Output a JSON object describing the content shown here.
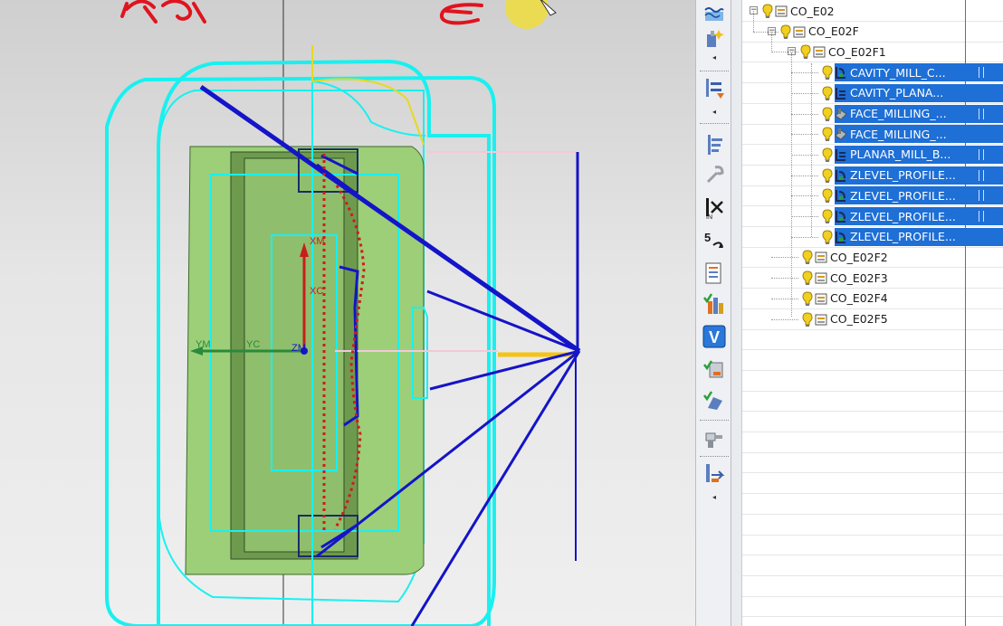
{
  "navigator": {
    "nodes": [
      {
        "label": "CO_E02",
        "level": 0,
        "type": "program",
        "expander": "−",
        "selected": false
      },
      {
        "label": "CO_E02F",
        "level": 1,
        "type": "program",
        "expander": "−",
        "selected": false
      },
      {
        "label": "CO_E02F1",
        "level": 2,
        "type": "program",
        "expander": "−",
        "selected": false
      },
      {
        "label": "CAVITY_MILL_C...",
        "level": 3,
        "type": "cavity-mill",
        "selected": true,
        "flag": true
      },
      {
        "label": "CAVITY_PLANA...",
        "level": 3,
        "type": "planar-mill",
        "selected": true,
        "flag": false
      },
      {
        "label": "FACE_MILLING_...",
        "level": 3,
        "type": "face-mill",
        "selected": true,
        "flag": true
      },
      {
        "label": "FACE_MILLING_...",
        "level": 3,
        "type": "face-mill",
        "selected": true,
        "flag": false
      },
      {
        "label": "PLANAR_MILL_B...",
        "level": 3,
        "type": "planar-mill",
        "selected": true,
        "flag": true
      },
      {
        "label": "ZLEVEL_PROFILE...",
        "level": 3,
        "type": "zlevel",
        "selected": true,
        "flag": true
      },
      {
        "label": "ZLEVEL_PROFILE...",
        "level": 3,
        "type": "zlevel",
        "selected": true,
        "flag": true
      },
      {
        "label": "ZLEVEL_PROFILE...",
        "level": 3,
        "type": "zlevel",
        "selected": true,
        "flag": true
      },
      {
        "label": "ZLEVEL_PROFILE...",
        "level": 3,
        "type": "zlevel",
        "selected": true,
        "flag": false
      },
      {
        "label": "CO_E02F2",
        "level": 2,
        "type": "program",
        "selected": false
      },
      {
        "label": "CO_E02F3",
        "level": 2,
        "type": "program",
        "selected": false
      },
      {
        "label": "CO_E02F4",
        "level": 2,
        "type": "program",
        "selected": false
      },
      {
        "label": "CO_E02F5",
        "level": 2,
        "type": "program",
        "selected": false
      }
    ]
  },
  "toolbar": {
    "icons": [
      "water-level-icon",
      "tool-sparkle-icon",
      "scroll-left-arrow",
      "insert-operation-icon",
      "scroll-left-arrow",
      "generate-path-icon",
      "wrench-icon",
      "cut-icon",
      "replay-icon",
      "list-icon",
      "verify-icon",
      "v-verify-icon",
      "check-tool-icon",
      "check-gouge-icon",
      "post-process-icon",
      "shop-doc-icon",
      "scroll-left-arrow"
    ]
  },
  "viewport": {
    "labels": {
      "xm": "XM",
      "xc": "XC",
      "ym": "YM",
      "yc": "YC",
      "zm": "ZM"
    },
    "annotation_colors": {
      "pen_red": "#e0141e",
      "wcs_cyan": "#19f0f0",
      "toolpath_blue": "#1414c8",
      "part_green": "#9ccf78",
      "path_red_dotted": "#d21a1a"
    }
  }
}
